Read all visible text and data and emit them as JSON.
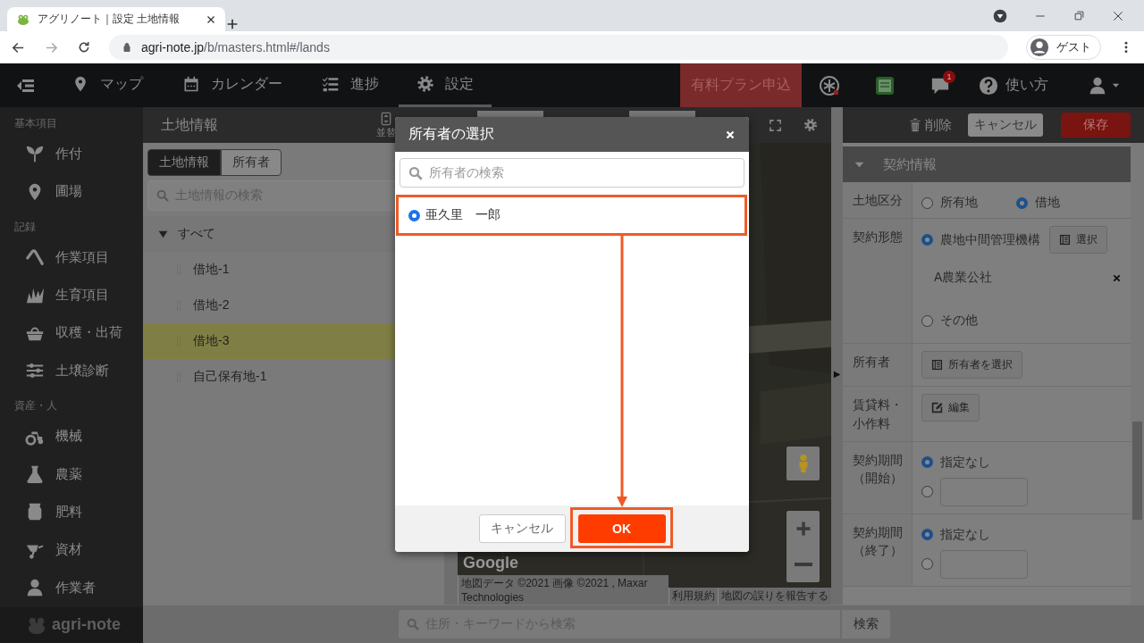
{
  "browser": {
    "tab_title": "アグリノート｜設定 土地情報",
    "url_host": "agri-note.jp",
    "url_path": "/b/masters.html#/lands",
    "profile": "ゲスト"
  },
  "nav": {
    "items": [
      {
        "label": "マップ",
        "selected": false
      },
      {
        "label": "カレンダー",
        "selected": false
      },
      {
        "label": "進捗",
        "selected": false
      },
      {
        "label": "設定",
        "selected": true
      }
    ],
    "plan_button": "有料プラン申込",
    "notification_count": "1",
    "help": "使い方"
  },
  "sidebar": {
    "groups": [
      {
        "heading": "基本項目",
        "items": [
          {
            "label": "作付"
          },
          {
            "label": "圃場"
          }
        ]
      },
      {
        "heading": "記録",
        "items": [
          {
            "label": "作業項目"
          },
          {
            "label": "生育項目"
          },
          {
            "label": "収穫・出荷"
          },
          {
            "label": "土壌診断"
          }
        ]
      },
      {
        "heading": "資産・人",
        "items": [
          {
            "label": "機械"
          },
          {
            "label": "農薬"
          },
          {
            "label": "肥料"
          },
          {
            "label": "資材"
          },
          {
            "label": "作業者"
          }
        ]
      }
    ],
    "logo": "agri-note"
  },
  "land_panel": {
    "title": "土地情報",
    "sort_label": "並替",
    "tabs": [
      {
        "label": "土地情報",
        "selected": true
      },
      {
        "label": "所有者",
        "selected": false
      }
    ],
    "search_placeholder": "土地情報の検索",
    "tree": {
      "label": "すべて",
      "expanded": true,
      "children": [
        {
          "label": "借地-1",
          "selected": false
        },
        {
          "label": "借地-2",
          "selected": false
        },
        {
          "label": "借地-3",
          "selected": true
        },
        {
          "label": "自己保有地-1",
          "selected": false
        }
      ]
    }
  },
  "map": {
    "logo": "Google",
    "attribution": "地図データ ©2021 画像 ©2021 , Maxar Technologies",
    "terms": "利用規約",
    "report": "地図の誤りを報告する",
    "search_placeholder": "住所・キーワードから検索",
    "search_button": "検索",
    "panel_toggle": "▶"
  },
  "detail_panel": {
    "delete": "削除",
    "cancel": "キャンセル",
    "save": "保存",
    "section": {
      "title": "契約情報",
      "expanded": true
    },
    "rows": [
      {
        "label": "土地区分",
        "kind": "radios",
        "options": [
          {
            "label": "所有地",
            "selected": false
          },
          {
            "label": "借地",
            "selected": true
          }
        ]
      },
      {
        "label": "契約形態",
        "kind": "contract",
        "options": [
          {
            "label": "農地中間管理機構",
            "selected": true
          },
          {
            "label": "その他",
            "selected": false
          }
        ],
        "select_button": "選択",
        "organization": "A農業公社"
      },
      {
        "label": "所有者",
        "kind": "button",
        "button": "所有者を選択"
      },
      {
        "label": "賃貸料・小作料",
        "kind": "edit",
        "button": "編集"
      },
      {
        "label": "契約期間（開始）",
        "kind": "period",
        "none_label": "指定なし",
        "unspecified": true
      },
      {
        "label": "契約期間（終了）",
        "kind": "period",
        "none_label": "指定なし",
        "unspecified": true
      }
    ]
  },
  "modal": {
    "title": "所有者の選択",
    "search_placeholder": "所有者の検索",
    "owners": [
      {
        "name": "亜久里　一郎",
        "selected": true
      }
    ],
    "cancel": "キャンセル",
    "ok": "OK"
  }
}
